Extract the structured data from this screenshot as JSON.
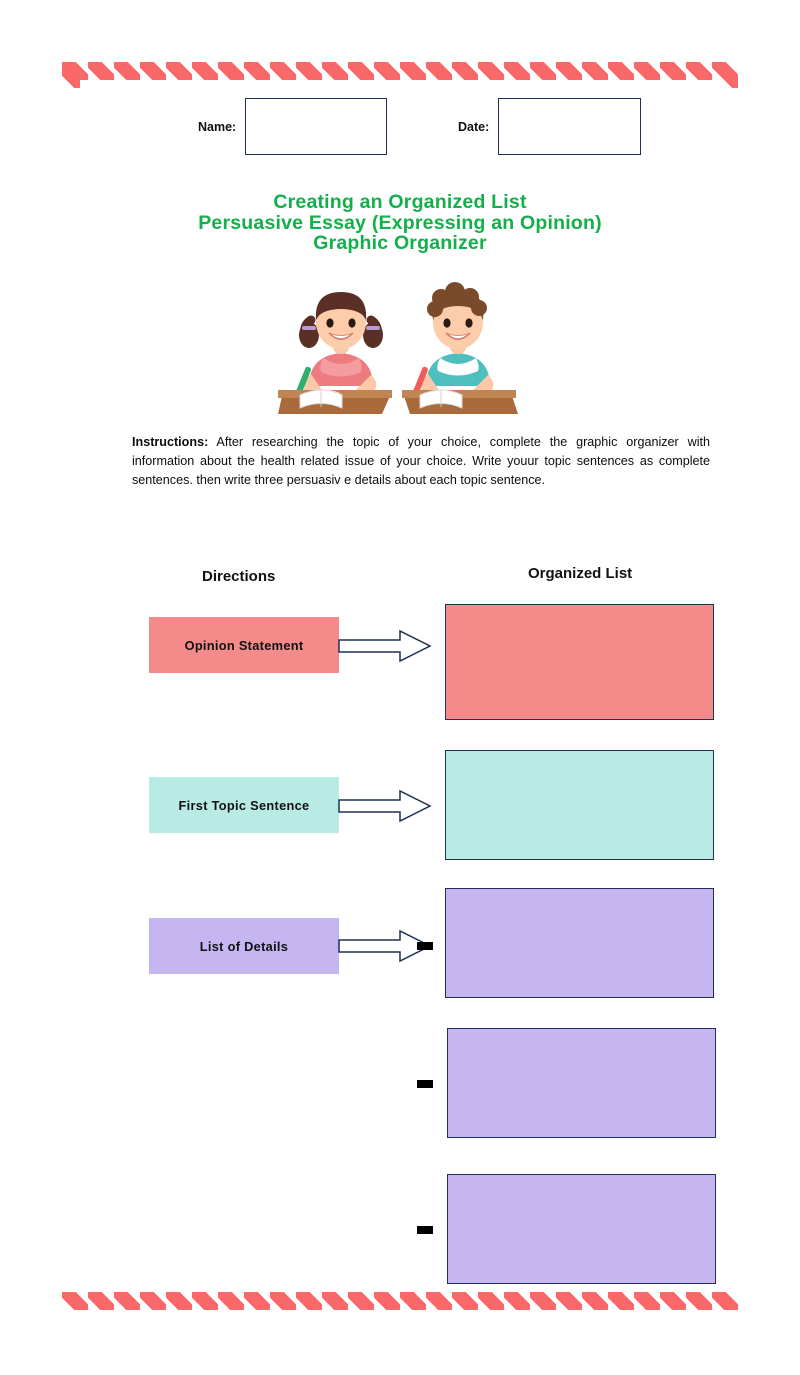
{
  "document": {
    "title_lines": [
      "Creating an Organized List",
      "Persuasive Essay  (Expressing an Opinion)",
      "Graphic Organizer"
    ],
    "title_color": "#12B04A"
  },
  "fields": {
    "name_label": "Name:",
    "name_value": "",
    "date_label": "Date:",
    "date_value": ""
  },
  "instructions": {
    "heading": "Instructions:",
    "body": " After researching the topic of  your choice, complete the graphic organizer with information about the health related issue of  your choice. Write youur topic sentences as complete sentences. then write three persuasiv e details about each topic sentence."
  },
  "columns": {
    "left_heading": "Directions",
    "right_heading": "Organized List"
  },
  "organizer": {
    "rows": [
      {
        "label": "Opinion Statement",
        "color": "#F58A8A",
        "answer_value": "",
        "has_arrow": true,
        "has_bullet": false
      },
      {
        "label": "First Topic Sentence",
        "color": "#B8EBE4",
        "answer_value": "",
        "has_arrow": true,
        "has_bullet": false
      },
      {
        "label": "List of Details",
        "color": "#C5B6F2",
        "answer_value": "",
        "has_arrow": true,
        "has_bullet": true
      },
      {
        "label": "",
        "color": "#C5B6F2",
        "answer_value": "",
        "has_arrow": false,
        "has_bullet": true
      },
      {
        "label": "",
        "color": "#C5B6F2",
        "answer_value": "",
        "has_arrow": false,
        "has_bullet": true
      }
    ]
  },
  "illustration": {
    "description": "two students writing at desks",
    "girl_shirt_color": "#EE7B80",
    "girl_hair_color": "#5A2F26",
    "girl_pencil_color": "#2EAF6B",
    "boy_shirt_color": "#4EBFBF",
    "boy_hair_color": "#7A4A2B",
    "boy_pencil_color": "#F05A5A",
    "desk_color": "#A96B3C"
  },
  "decor": {
    "border_style": "diamond-chain",
    "border_color": "#FA6969"
  }
}
